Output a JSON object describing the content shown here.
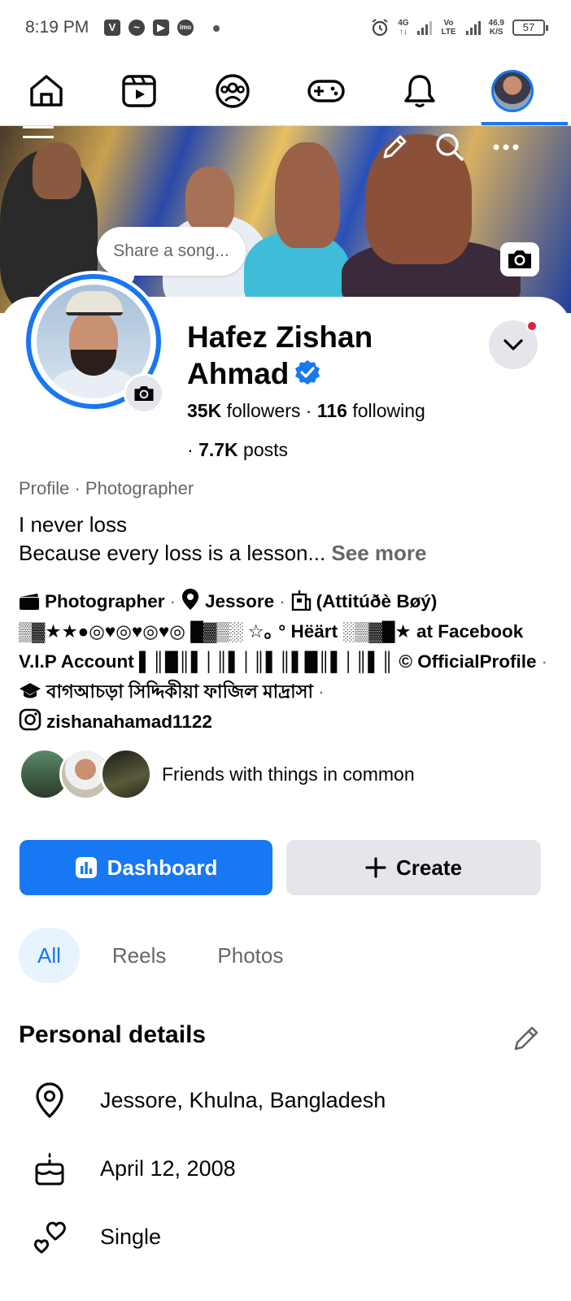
{
  "status_bar": {
    "time": "8:19 PM",
    "app_icons": [
      "V",
      "messenger",
      "youtube",
      "imo"
    ],
    "network_1": "4G",
    "network_2": "Vo LTE",
    "speed_value": "46.9",
    "speed_unit": "K/S",
    "battery": "57"
  },
  "nav": {
    "items": [
      "home-icon",
      "video-icon",
      "groups-icon",
      "gaming-icon",
      "bell-icon",
      "profile-avatar"
    ],
    "active": "profile-avatar"
  },
  "cover": {
    "song_prompt": "Share a song..."
  },
  "profile": {
    "name": "Hafez Zishan Ahmad",
    "verified": true,
    "followers_count": "35K",
    "followers_label": "followers",
    "following_count": "116",
    "following_label": "following",
    "posts_count": "7.7K",
    "posts_label": "posts",
    "category": "Profile · Photographer",
    "bio_line1": "I never loss",
    "bio_line2": "Because every loss is a lesson...",
    "see_more": "See more",
    "intro": {
      "work": "Photographer",
      "location": "Jessore",
      "nickname": "(Attitúðè Bøý)",
      "tagline": "▒▓★★●◎♥◎♥◎♥◎ █▓▒░ ☆｡ ° Hëärt ░▒▓█★ at Facebook V.I.P Account ▌║█║▌│║▌│║▌║▌█║▌│║▌║ © OfficialProfile",
      "school": "বাগআচড়া সিদ্দিকীয়া ফাজিল মাদ্রাসা",
      "instagram": "zishanahamad1122"
    },
    "friends_label": "Friends with things in common"
  },
  "actions": {
    "dashboard_label": "Dashboard",
    "create_label": "Create"
  },
  "tabs": [
    "All",
    "Reels",
    "Photos"
  ],
  "personal_details": {
    "title": "Personal details",
    "location": "Jessore, Khulna, Bangladesh",
    "birthday": "April 12, 2008",
    "relationship": "Single"
  },
  "colors": {
    "accent": "#1877f2",
    "button_secondary": "#e4e6eb",
    "muted_text": "#65676b",
    "notification_dot": "#e41e3f"
  }
}
